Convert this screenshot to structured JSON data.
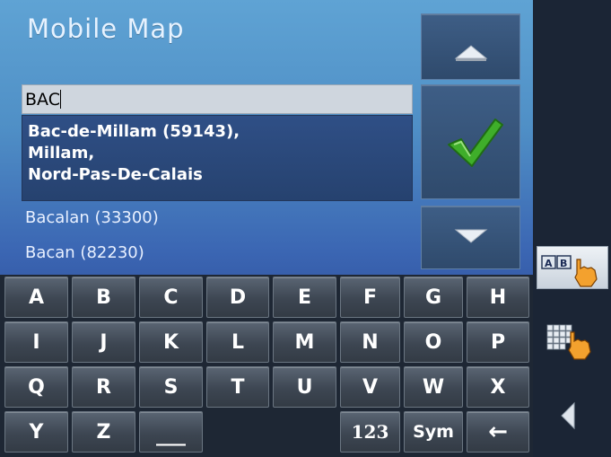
{
  "app": {
    "title": "Mobile Map"
  },
  "search": {
    "value": "BAC"
  },
  "results": {
    "selected_lines": [
      "Bac-de-Millam (59143),",
      "Millam,",
      "Nord-Pas-De-Calais"
    ],
    "items": [
      "Bacalan (33300)",
      "Bacan (82230)"
    ]
  },
  "keyboard": {
    "rows": [
      [
        "A",
        "B",
        "C",
        "D",
        "E",
        "F",
        "G",
        "H"
      ],
      [
        "I",
        "J",
        "K",
        "L",
        "M",
        "N",
        "O",
        "P"
      ],
      [
        "Q",
        "R",
        "S",
        "T",
        "U",
        "V",
        "W",
        "X"
      ]
    ],
    "last": {
      "y": "Y",
      "z": "Z",
      "space": "___",
      "num": "123",
      "sym": "Sym",
      "back": "←"
    }
  },
  "icons": {
    "up": "triangle-up-icon",
    "confirm": "checkmark-icon",
    "down": "triangle-down-icon",
    "ab_mode": "ab-keyboard-hand-icon",
    "grid_mode": "grid-keyboard-hand-icon",
    "back": "triangle-left-icon"
  },
  "colors": {
    "accent_check": "#3fae2a",
    "panel_top": "#5fa3d4",
    "panel_bottom": "#2a3f7e"
  }
}
